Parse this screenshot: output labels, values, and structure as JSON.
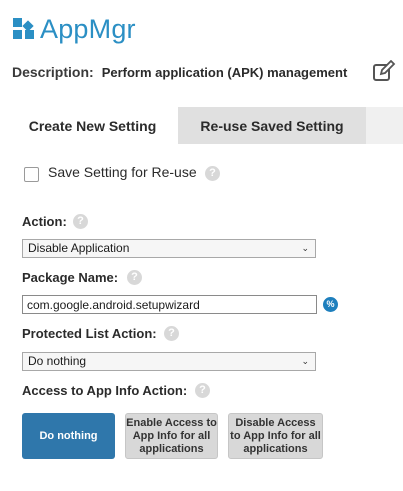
{
  "app": {
    "title": "AppMgr",
    "logo_icon": "apps-grid-icon",
    "accent_color": "#2b8fc4"
  },
  "description": {
    "label": "Description:",
    "value": "Perform application (APK) management",
    "edit_icon": "edit-pencil-icon"
  },
  "tabs": [
    {
      "label": "Create New Setting",
      "active": true
    },
    {
      "label": "Re-use Saved Setting",
      "active": false
    }
  ],
  "save_setting": {
    "label": "Save Setting for Re-use",
    "checked": false
  },
  "action": {
    "label": "Action:",
    "value": "Disable Application"
  },
  "package": {
    "label": "Package Name:",
    "value": "com.google.android.setupwizard",
    "variable_button": "%"
  },
  "protected_list": {
    "label": "Protected List Action:",
    "value": "Do nothing"
  },
  "app_info": {
    "label": "Access to App Info Action:",
    "options": [
      {
        "label": "Do nothing",
        "selected": true
      },
      {
        "label": "Enable Access to App Info for all applications",
        "selected": false
      },
      {
        "label": "Disable Access to App Info for all applications",
        "selected": false
      }
    ],
    "selected_color": "#2f77ab"
  },
  "help_glyph": "?"
}
